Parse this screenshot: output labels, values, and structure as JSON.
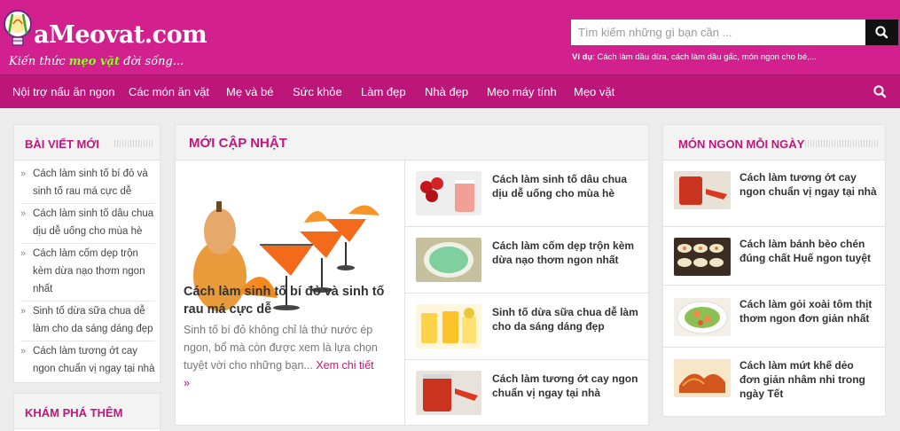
{
  "header": {
    "logo_text": "aMeovat.com",
    "tagline_a": "Kiến thức ",
    "tagline_b": "mẹo vặt",
    "tagline_c": " đời sống...",
    "search_placeholder": "Tìm kiếm những gì bạn cần ...",
    "example_label": "Ví dụ",
    "example_text": ": Cách làm dầu dừa, cách làm dầu gấc, món ngon cho bé,..."
  },
  "nav": {
    "items": [
      "Nội trợ nấu ăn ngon",
      "Các món ăn vặt",
      "Mẹ và bé",
      "Sức khỏe",
      "Làm đẹp",
      "Nhà đẹp",
      "Mẹo máy tính",
      "Mẹo vặt"
    ]
  },
  "left": {
    "title": "BÀI VIẾT MỚI",
    "items": [
      "Cách làm sinh tố bí đỏ và sinh tố rau má cực dễ",
      "Cách làm sinh tố dâu chua dịu dễ uống cho mùa hè",
      "Cách làm cốm dẹp trộn kèm dừa nạo thơm ngon nhất",
      "Sinh tố dừa sữa chua dễ làm cho da sáng dáng đẹp",
      "Cách làm tương ớt cay ngon chuẩn vị ngay tại nhà"
    ],
    "title2": "KHÁM PHÁ THÊM"
  },
  "middle": {
    "title": "MỚI CẬP NHẬT",
    "featured_title": "Cách làm sinh tố bí đỏ và sinh tố rau má cực dễ",
    "featured_desc": "Sinh tố bí đỏ không chỉ là thứ nước ép ngon, bổ mà còn được xem là lựa chọn tuyệt vời cho những bạn...",
    "featured_more": "Xem chi tiết »",
    "items": [
      "Cách làm sinh tố dâu chua dịu dễ uống cho mùa hè",
      "Cách làm cốm dẹp trộn kèm dừa nạo thơm ngon nhất",
      "Sinh tố dừa sữa chua dễ làm cho da sáng dáng đẹp",
      "Cách làm tương ớt cay ngon chuẩn vị ngay tại nhà"
    ]
  },
  "right": {
    "title": "MÓN NGON MỖI NGÀY",
    "items": [
      "Cách làm tương ớt cay ngon chuẩn vị ngay tại nhà",
      "Cách làm bánh bèo chén đúng chất Huế ngon tuyệt",
      "Cách làm gỏi xoài tôm thịt thơm ngon đơn giản nhất",
      "Cách làm mứt khế dẻo đơn giản nhâm nhi trong ngày Tết"
    ]
  },
  "colors": {
    "brand": "#d2208e",
    "nav": "#bd1679",
    "accent_text": "#c0177a",
    "tagline_highlight": "#8cff2a"
  }
}
